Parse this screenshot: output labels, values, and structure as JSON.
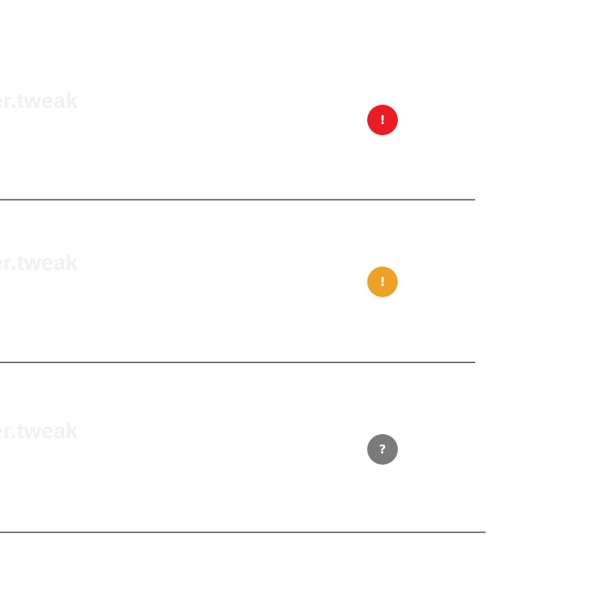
{
  "rows": [
    {
      "label": "per.tweak",
      "status": "error",
      "icon": "exclamation-icon",
      "symbol": "!",
      "color": "#ec1c24"
    },
    {
      "label": "per.tweak",
      "status": "warning",
      "icon": "exclamation-icon",
      "symbol": "!",
      "color": "#eda126"
    },
    {
      "label": "per.tweak",
      "status": "unknown",
      "icon": "question-icon",
      "symbol": "?",
      "color": "#7b7b7b"
    }
  ],
  "divider_color": "#7a7a7a"
}
